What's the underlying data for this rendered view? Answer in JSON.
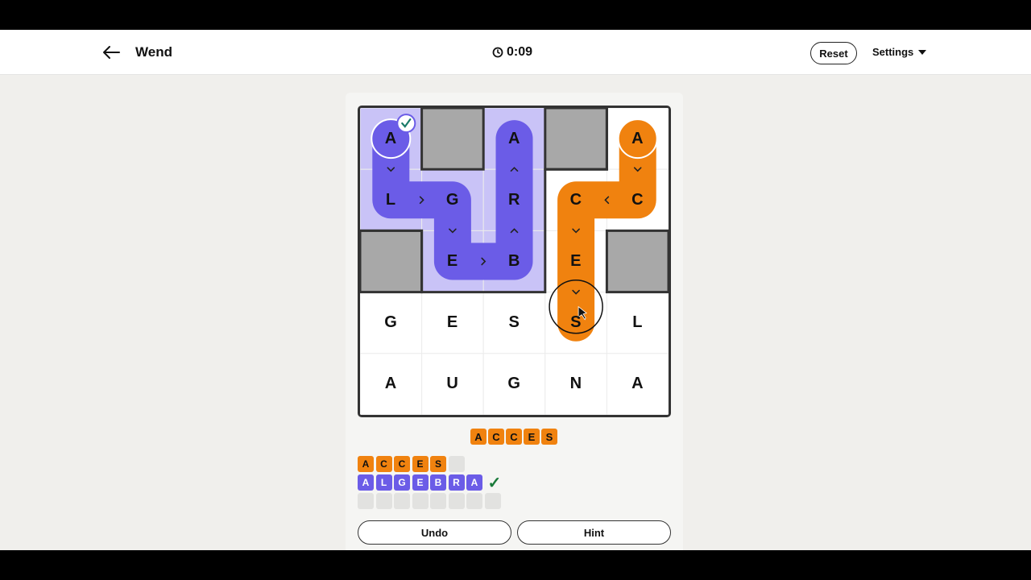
{
  "header": {
    "title": "Wend",
    "timer": "0:09",
    "reset_label": "Reset",
    "settings_label": "Settings"
  },
  "board": {
    "rows": [
      [
        "A",
        "",
        "A",
        "",
        "A"
      ],
      [
        "L",
        "G",
        "R",
        "C",
        "C"
      ],
      [
        "",
        "E",
        "B",
        "E",
        ""
      ],
      [
        "G",
        "E",
        "S",
        "S",
        "L"
      ],
      [
        "A",
        "U",
        "G",
        "N",
        "A"
      ]
    ],
    "blocked_cells": [
      [
        0,
        1
      ],
      [
        0,
        3
      ],
      [
        2,
        0
      ],
      [
        2,
        4
      ]
    ],
    "paths": [
      {
        "word": "ALGEBRA",
        "color": "#6b5ce7",
        "cells": [
          [
            0,
            0
          ],
          [
            1,
            0
          ],
          [
            1,
            1
          ],
          [
            2,
            1
          ],
          [
            2,
            2
          ],
          [
            1,
            2
          ],
          [
            0,
            2
          ]
        ],
        "solved": true
      },
      {
        "word": "ACCES",
        "color": "#f0820f",
        "cells": [
          [
            0,
            4
          ],
          [
            1,
            4
          ],
          [
            1,
            3
          ],
          [
            2,
            3
          ],
          [
            3,
            3
          ]
        ],
        "solved": false
      }
    ]
  },
  "current_word": [
    "A",
    "C",
    "C",
    "E",
    "S"
  ],
  "word_rows": [
    {
      "letters": [
        "A",
        "C",
        "C",
        "E",
        "S"
      ],
      "slots": 6,
      "color": "orange",
      "solved": false
    },
    {
      "letters": [
        "A",
        "L",
        "G",
        "E",
        "B",
        "R",
        "A"
      ],
      "slots": 7,
      "color": "purple",
      "solved": true
    },
    {
      "letters": [],
      "slots": 8,
      "color": "empty",
      "solved": false
    }
  ],
  "buttons": {
    "undo_label": "Undo",
    "hint_label": "Hint"
  },
  "colors": {
    "purple": "#6b5ce7",
    "purple_light": "#c9c3f7",
    "orange": "#f0820f",
    "blocked": "#a8a8a8"
  }
}
